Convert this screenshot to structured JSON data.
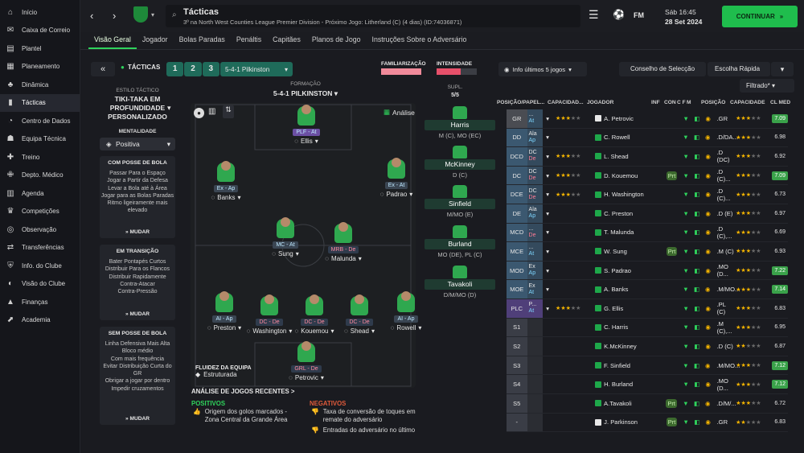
{
  "sidebar": {
    "items": [
      {
        "label": "Início",
        "icon": "home-icon"
      },
      {
        "label": "Caixa de Correio",
        "icon": "mail-icon"
      },
      {
        "label": "Plantel",
        "icon": "squad-icon"
      },
      {
        "label": "Planeamento",
        "icon": "calendar-icon"
      },
      {
        "label": "Dinâmica",
        "icon": "dynamics-icon"
      },
      {
        "label": "Tácticas",
        "icon": "tactics-icon"
      },
      {
        "label": "Centro de Dados",
        "icon": "data-icon"
      },
      {
        "label": "Equipa Técnica",
        "icon": "staff-icon"
      },
      {
        "label": "Treino",
        "icon": "training-icon"
      },
      {
        "label": "Depto. Médico",
        "icon": "medical-icon"
      },
      {
        "label": "Agenda",
        "icon": "agenda-icon"
      },
      {
        "label": "Competições",
        "icon": "trophy-icon"
      },
      {
        "label": "Observação",
        "icon": "scouting-icon"
      },
      {
        "label": "Transferências",
        "icon": "transfer-icon"
      },
      {
        "label": "Info. do Clube",
        "icon": "club-icon"
      },
      {
        "label": "Visão do Clube",
        "icon": "vision-icon"
      },
      {
        "label": "Finanças",
        "icon": "finance-icon"
      },
      {
        "label": "Academia",
        "icon": "academy-icon"
      }
    ]
  },
  "header": {
    "title": "Tácticas",
    "subtitle": "3º na North West Counties League Premier Division - Próximo Jogo: Litherland (C) (4 dias) (ID:74036871)",
    "day": "Sáb 16:45",
    "date": "28 Set 2024",
    "continue": "CONTINUAR",
    "fm": "FM"
  },
  "tabs": [
    "Visão Geral",
    "Jogador",
    "Bolas Paradas",
    "Penáltis",
    "Capitães",
    "Planos de Jogo",
    "Instruções Sobre o Adversário"
  ],
  "tactics_bar": {
    "label": "TÁCTICAS",
    "slots": [
      "1",
      "2",
      "3"
    ],
    "formation": "5-4-1 Pilkinston",
    "familiarity": "FAMILIARIZAÇÃO",
    "intensity": "INTENSIDADE",
    "info": "Info últimos 5 jogos",
    "advice": "Conselho de Selecção",
    "quick": "Escolha Rápida",
    "filtered": "Filtrado*"
  },
  "style": {
    "label": "ESTILO TÁCTICO",
    "name": "TIKI-TAKA EM PROFUNDIDADE PERSONALIZADO",
    "mentality_label": "MENTALIDADE",
    "mentality": "Positiva",
    "in_possession": {
      "title": "COM POSSE DE BOLA",
      "items": [
        "Passar Para o Espaço",
        "Jogar a Partir da Defesa",
        "Levar a Bola até à Área",
        "Jogar para as Bolas Paradas",
        "Ritmo ligeiramente mais elevado"
      ]
    },
    "transition": {
      "title": "EM TRANSIÇÃO",
      "items": [
        "Bater Pontapés Curtos",
        "Distribuir Para os Flancos",
        "Distribuir Rapidamente",
        "Contra-Atacar",
        "Contra-Pressão"
      ]
    },
    "out_possession": {
      "title": "SEM POSSE DE BOLA",
      "items": [
        "Linha Defensiva Mais Alta",
        "Bloco médio",
        "Com mais frequência",
        "Evitar Distribuição Curta do GR",
        "Obrigar a jogar por dentro",
        "Impedir cruzamentos"
      ]
    },
    "change": "MUDAR"
  },
  "formation": {
    "label": "FORMAÇÃO",
    "name": "5-4-1 PILKINSTON",
    "analysis": "Análise",
    "fluidity_label": "FLUIDEZ DA EQUIPA",
    "fluidity": "Estruturada"
  },
  "pitch_players": [
    {
      "role": "PLF - At",
      "name": "Ellis"
    },
    {
      "role": "Ex - Ap",
      "name": "Banks"
    },
    {
      "role": "Ex - At",
      "name": "Padrao"
    },
    {
      "role": "MC - At",
      "name": "Sung"
    },
    {
      "role": "MRB - De",
      "name": "Malunda"
    },
    {
      "role": "AI - Ap",
      "name": "Preston"
    },
    {
      "role": "DC - De",
      "name": "Washington"
    },
    {
      "role": "DC - De",
      "name": "Kouemou"
    },
    {
      "role": "DC - De",
      "name": "Shead"
    },
    {
      "role": "AI - Ap",
      "name": "Rowell"
    },
    {
      "role": "GRL - De",
      "name": "Petrovic"
    }
  ],
  "subs": {
    "label": "SUPL.",
    "count": "5/5",
    "list": [
      {
        "name": "Harris",
        "pos": "M (C), MO (EC)"
      },
      {
        "name": "McKinney",
        "pos": "D (C)"
      },
      {
        "name": "Sinfield",
        "pos": "M/MO (E)"
      },
      {
        "name": "Burland",
        "pos": "MO (DE), PL (C)"
      },
      {
        "name": "Tavakoli",
        "pos": "D/M/MO (D)"
      }
    ]
  },
  "analysis": {
    "title": "ANÁLISE DE JOGOS RECENTES >",
    "positives": "POSITIVOS",
    "negatives": "NEGATIVOS",
    "pos_items": [
      "Origem dos golos marcados - Zona Central da Grande Área"
    ],
    "neg_items": [
      "Taxa de conversão de toques em remate do adversário",
      "Entradas do adversário no último"
    ]
  },
  "table": {
    "headers": [
      "POSIÇÃO/PAPEL...",
      "CAPACIDAD...",
      "JOGADOR",
      "INF",
      "CON",
      "C F",
      "M",
      "POSIÇÃO",
      "CAPACIDADE",
      "CL MED"
    ],
    "rows": [
      {
        "pos": "GR",
        "role": [
          "...",
          "At"
        ],
        "cap": 2.5,
        "name": "A. Petrovic",
        "gk": true,
        "inf": "",
        "np": ".GR",
        "pcap": 3,
        "cl": "7.09",
        "hi": true
      },
      {
        "pos": "DD",
        "role": [
          "Ala",
          "Ap"
        ],
        "cap": 0,
        "name": "C. Rowell",
        "gk": false,
        "inf": "",
        "np": ".D/DA...",
        "pcap": 3,
        "cl": "6.98",
        "hi": false
      },
      {
        "pos": "DCD",
        "role": [
          "DC",
          "De"
        ],
        "cap": 2.5,
        "name": "L. Shead",
        "gk": false,
        "inf": "",
        "np": ".D (DC)",
        "pcap": 3,
        "cl": "6.92",
        "hi": false
      },
      {
        "pos": "DC",
        "role": [
          "DC",
          "De"
        ],
        "cap": 2.5,
        "name": "D. Kouemou",
        "gk": false,
        "inf": "Prt",
        "np": ".D (C)...",
        "pcap": 3,
        "cl": "7.09",
        "hi": true
      },
      {
        "pos": "DCE",
        "role": [
          "DC",
          "De"
        ],
        "cap": 2.5,
        "name": "H. Washington",
        "gk": false,
        "inf": "",
        "np": ".D (C)...",
        "pcap": 2.5,
        "cl": "6.73",
        "hi": false
      },
      {
        "pos": "DE",
        "role": [
          "Ala",
          "Ap"
        ],
        "cap": 0,
        "name": "C. Preston",
        "gk": false,
        "inf": "",
        "np": ".D (E)",
        "pcap": 3,
        "cl": "6.97",
        "hi": false
      },
      {
        "pos": "MCD",
        "role": [
          "...",
          "De"
        ],
        "cap": 0,
        "name": "T. Malunda",
        "gk": false,
        "inf": "",
        "np": ".D (C),...",
        "pcap": 2.5,
        "cl": "6.69",
        "hi": false
      },
      {
        "pos": "MCE",
        "role": [
          "...",
          "At"
        ],
        "cap": 0,
        "name": "W. Sung",
        "gk": false,
        "inf": "Prt",
        "np": ".M (C)",
        "pcap": 3,
        "cl": "6.93",
        "hi": false
      },
      {
        "pos": "MOD",
        "role": [
          "Ex",
          "Ap"
        ],
        "cap": 0,
        "name": "S. Padrao",
        "gk": false,
        "inf": "",
        "np": ".MO (D...",
        "pcap": 3,
        "cl": "7.22",
        "hi": true
      },
      {
        "pos": "MOE",
        "role": [
          "Ex",
          "At"
        ],
        "cap": 0,
        "name": "A. Banks",
        "gk": false,
        "inf": "",
        "np": ".M/MO...",
        "pcap": 3,
        "cl": "7.14",
        "hi": true
      },
      {
        "pos": "PLC",
        "role": [
          "P...",
          "At"
        ],
        "cap": 3,
        "name": "G. Ellis",
        "gk": false,
        "inf": "",
        "np": ".PL (C)",
        "pcap": 2.5,
        "cl": "6.83",
        "hi": false
      },
      {
        "pos": "S1",
        "role": [
          "",
          ""
        ],
        "cap": 0,
        "name": "C. Harris",
        "gk": false,
        "inf": "",
        "np": ".M (C),...",
        "pcap": 3,
        "cl": "6.95",
        "hi": false
      },
      {
        "pos": "S2",
        "role": [
          "",
          ""
        ],
        "cap": 0,
        "name": "K.McKinney",
        "gk": false,
        "inf": "",
        "np": ".D (C)",
        "pcap": 2,
        "cl": "6.87",
        "hi": false
      },
      {
        "pos": "S3",
        "role": [
          "",
          ""
        ],
        "cap": 0,
        "name": "F. Sinfield",
        "gk": false,
        "inf": "",
        "np": ".M/MO...",
        "pcap": 3,
        "cl": "7.12",
        "hi": true
      },
      {
        "pos": "S4",
        "role": [
          "",
          ""
        ],
        "cap": 0,
        "name": "H. Burland",
        "gk": false,
        "inf": "",
        "np": ".MO (D...",
        "pcap": 2.5,
        "cl": "7.12",
        "hi": true
      },
      {
        "pos": "S5",
        "role": [
          "",
          ""
        ],
        "cap": 0,
        "name": "A.Tavakoli",
        "gk": false,
        "inf": "Prt",
        "np": ".D/M/...",
        "pcap": 2.5,
        "cl": "6.72",
        "hi": false
      },
      {
        "pos": "-",
        "role": [
          "",
          ""
        ],
        "cap": 0,
        "name": "J. Parkinson",
        "gk": true,
        "inf": "Prt",
        "np": ".GR",
        "pcap": 2,
        "cl": "6.83",
        "hi": false
      }
    ]
  },
  "colors": {
    "accent": "#2fd35c",
    "panel": "#23252b",
    "bg": "#1a1b20",
    "star": "#f4b400"
  }
}
